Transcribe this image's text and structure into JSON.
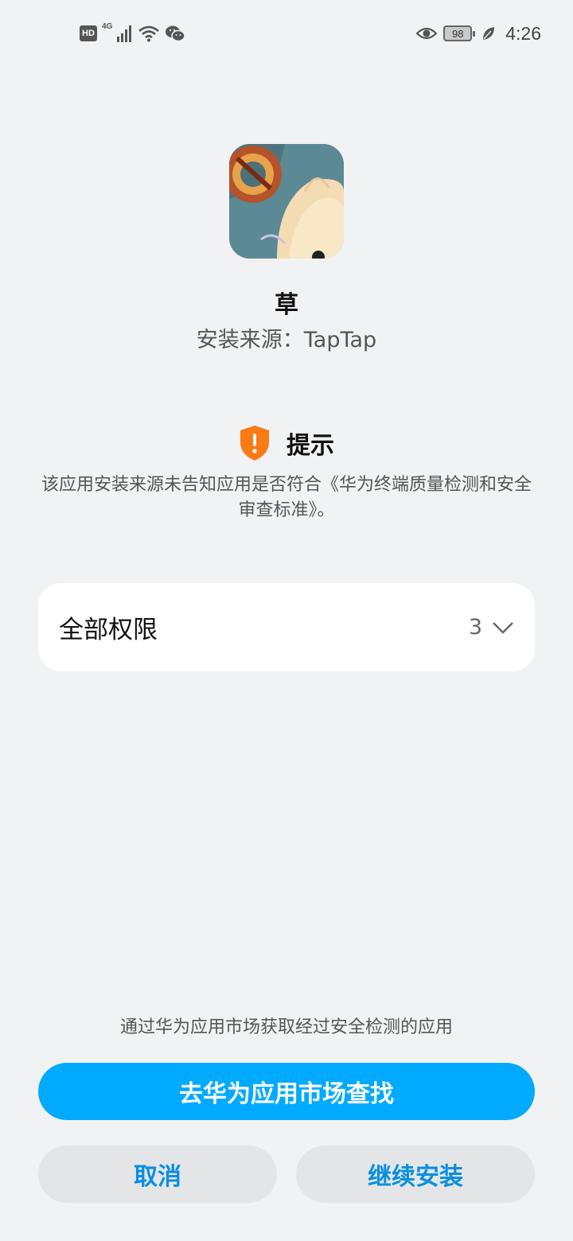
{
  "status_bar": {
    "hd_label": "HD",
    "network_type": "4G",
    "battery_level": "98",
    "time": "4:26",
    "icons": [
      "signal-icon",
      "wifi-icon",
      "wechat-icon",
      "eye-icon",
      "leaf-icon"
    ]
  },
  "app": {
    "name": "草",
    "install_source": "安装来源：TapTap"
  },
  "notice": {
    "title": "提示",
    "text": "该应用安装来源未告知应用是否符合《华为终端质量检测和安全审查标准》。",
    "icon": "warning-shield-icon",
    "icon_color": "#fa7a14"
  },
  "permissions": {
    "label": "全部权限",
    "count": "3"
  },
  "footer": {
    "hint": "通过华为应用市场获取经过安全检测的应用",
    "primary_button": "去华为应用市场查找",
    "cancel_button": "取消",
    "continue_button": "继续安装"
  },
  "colors": {
    "accent": "#00aaff",
    "secondary_text_button": "#0a8fe0",
    "background": "#f1f2f4"
  }
}
